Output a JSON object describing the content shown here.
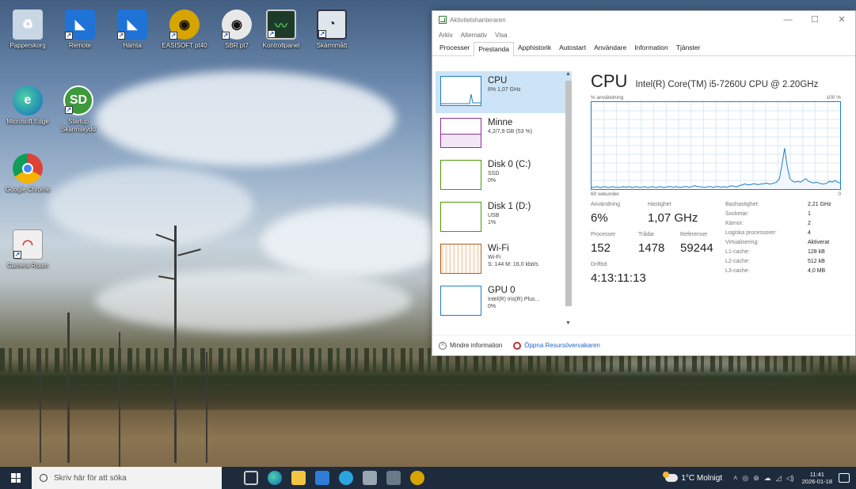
{
  "desktop": {
    "icons": [
      {
        "label": "Papperskorg",
        "icon": "recycle-bin-icon"
      },
      {
        "label": "Remote",
        "icon": "remote-icon"
      },
      {
        "label": "Hämta",
        "icon": "download-icon"
      },
      {
        "label": "EASISOFT pt40",
        "icon": "easisoft-icon"
      },
      {
        "label": "SBR pt7",
        "icon": "sbr-icon"
      },
      {
        "label": "Kontrollpanel",
        "icon": "control-panel-icon"
      },
      {
        "label": "Skärmmått",
        "icon": "meter-icon"
      },
      {
        "label": "Microsoft Edge",
        "icon": "edge-icon"
      },
      {
        "label": "Startup Skärmskydd",
        "icon": "sd-icon"
      },
      {
        "label": "Google Chrome",
        "icon": "chrome-icon"
      },
      {
        "label": "Camera Roam",
        "icon": "camera-icon"
      }
    ]
  },
  "taskmanager": {
    "title": "Aktivitetshanteraren",
    "menu": [
      "Arkiv",
      "Alternativ",
      "Visa"
    ],
    "tabs": [
      "Processer",
      "Prestanda",
      "Apphistorik",
      "Autostart",
      "Användare",
      "Information",
      "Tjänster"
    ],
    "active_tab": "Prestanda",
    "resources": [
      {
        "name": "CPU",
        "sub1": "6% 1,07 GHz",
        "sub2": "",
        "color": "#1f7ec4"
      },
      {
        "name": "Minne",
        "sub1": "4,2/7,9 GB (53 %)",
        "sub2": "",
        "color": "#8b2f9e"
      },
      {
        "name": "Disk 0 (C:)",
        "sub1": "SSD",
        "sub2": "0%",
        "color": "#4e9a06"
      },
      {
        "name": "Disk 1 (D:)",
        "sub1": "USB",
        "sub2": "1%",
        "color": "#4e9a06"
      },
      {
        "name": "Wi-Fi",
        "sub1": "Wi-Fi",
        "sub2": "S: 144 M: 16,0 kbit/s",
        "color": "#a8632a"
      },
      {
        "name": "GPU 0",
        "sub1": "Intel(R) Iris(R) Plus...",
        "sub2": "0%",
        "color": "#1f7ec4"
      }
    ],
    "cpu": {
      "heading": "CPU",
      "model": "Intel(R) Core(TM) i5-7260U CPU @ 2.20GHz",
      "graph_label_left": "% användning",
      "graph_label_right": "100 %",
      "time_label_left": "60 sekunder",
      "time_label_right": "0",
      "usage_label": "Användning",
      "usage_value": "6%",
      "speed_label": "Hastighet",
      "speed_value": "1,07 GHz",
      "processes_label": "Processer",
      "processes_value": "152",
      "threads_label": "Trådar",
      "threads_value": "1478",
      "handles_label": "Referenser",
      "handles_value": "59244",
      "uptime_label": "Drifttid",
      "uptime_value": "4:13:11:13",
      "specs": [
        {
          "key": "Bashastighet:",
          "value": "2,21 GHz"
        },
        {
          "key": "Socketar:",
          "value": "1"
        },
        {
          "key": "Kärnor:",
          "value": "2"
        },
        {
          "key": "Logiska processorer:",
          "value": "4"
        },
        {
          "key": "Virtualisering:",
          "value": "Aktiverat"
        },
        {
          "key": "L1-cache:",
          "value": "128 kB"
        },
        {
          "key": "L2-cache:",
          "value": "512 kB"
        },
        {
          "key": "L3-cache:",
          "value": "4,0 MB"
        }
      ],
      "usage_history": [
        2,
        2,
        3,
        2,
        2,
        3,
        2,
        2,
        3,
        2,
        2,
        2,
        3,
        2,
        3,
        2,
        2,
        3,
        2,
        2,
        3,
        2,
        2,
        3,
        2,
        2,
        3,
        2,
        2,
        3,
        3,
        2,
        3,
        2,
        2,
        3,
        3,
        2,
        3,
        4,
        3,
        3,
        2,
        2,
        3,
        3,
        2,
        3,
        3,
        2,
        3,
        2,
        3,
        4,
        3,
        3,
        4,
        5,
        6,
        5,
        5,
        6,
        6,
        5,
        6,
        6,
        7,
        6,
        6,
        7,
        8,
        12,
        28,
        47,
        26,
        12,
        9,
        8,
        9,
        8,
        10,
        12,
        9,
        8,
        7,
        8,
        7,
        6,
        6,
        7,
        9,
        8,
        10,
        8,
        7
      ]
    },
    "footer": {
      "less_info": "Mindre information",
      "open_resmon": "Öppna Resursövervakaren"
    }
  },
  "taskbar": {
    "search_placeholder": "Skriv här för att söka",
    "weather": "1°C  Molnigt",
    "time": "11:41",
    "date": "2026-01-18"
  }
}
